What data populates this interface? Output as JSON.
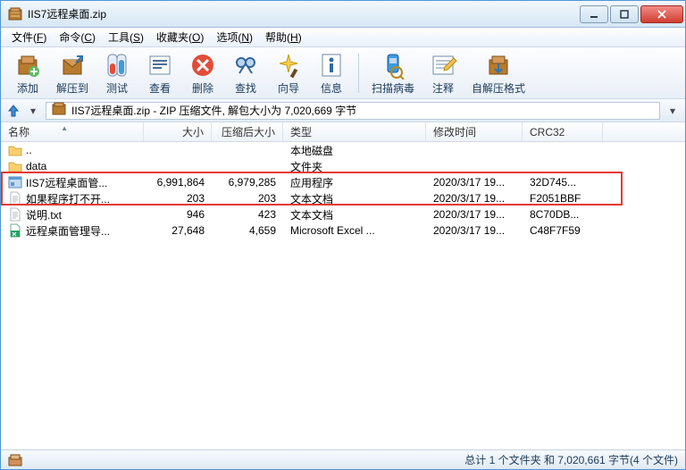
{
  "title": "IIS7远程桌面.zip",
  "menus": [
    {
      "label": "文件",
      "key": "F"
    },
    {
      "label": "命令",
      "key": "C"
    },
    {
      "label": "工具",
      "key": "S"
    },
    {
      "label": "收藏夹",
      "key": "O"
    },
    {
      "label": "选项",
      "key": "N"
    },
    {
      "label": "帮助",
      "key": "H"
    }
  ],
  "toolbar": [
    {
      "name": "add",
      "label": "添加"
    },
    {
      "name": "extract",
      "label": "解压到"
    },
    {
      "name": "test",
      "label": "测试"
    },
    {
      "name": "view",
      "label": "查看"
    },
    {
      "name": "delete",
      "label": "删除"
    },
    {
      "name": "find",
      "label": "查找"
    },
    {
      "name": "wizard",
      "label": "向导"
    },
    {
      "name": "info",
      "label": "信息"
    },
    {
      "type": "sep"
    },
    {
      "name": "scan",
      "label": "扫描病毒"
    },
    {
      "name": "comment",
      "label": "注释"
    },
    {
      "name": "sfx",
      "label": "自解压格式"
    }
  ],
  "address": "IIS7远程桌面.zip - ZIP 压缩文件, 解包大小为 7,020,669 字节",
  "columns": {
    "name": "名称",
    "size": "大小",
    "packed": "压缩后大小",
    "type": "类型",
    "mtime": "修改时间",
    "crc": "CRC32"
  },
  "rows": [
    {
      "icon": "folder",
      "name": "..",
      "size": "",
      "packed": "",
      "type": "本地磁盘",
      "mtime": "",
      "crc": ""
    },
    {
      "icon": "folder",
      "name": "data",
      "size": "",
      "packed": "",
      "type": "文件夹",
      "mtime": "",
      "crc": ""
    },
    {
      "icon": "exe",
      "name": "IIS7远程桌面管...",
      "size": "6,991,864",
      "packed": "6,979,285",
      "type": "应用程序",
      "mtime": "2020/3/17 19...",
      "crc": "32D745...",
      "highlight": true
    },
    {
      "icon": "txt",
      "name": "如果程序打不开...",
      "size": "203",
      "packed": "203",
      "type": "文本文档",
      "mtime": "2020/3/17 19...",
      "crc": "F2051BBF"
    },
    {
      "icon": "txt",
      "name": "说明.txt",
      "size": "946",
      "packed": "423",
      "type": "文本文档",
      "mtime": "2020/3/17 19...",
      "crc": "8C70DB..."
    },
    {
      "icon": "xls",
      "name": "远程桌面管理导...",
      "size": "27,648",
      "packed": "4,659",
      "type": "Microsoft Excel ...",
      "mtime": "2020/3/17 19...",
      "crc": "C48F7F59"
    }
  ],
  "status": "总计 1 个文件夹 和 7,020,661 字节(4 个文件)"
}
